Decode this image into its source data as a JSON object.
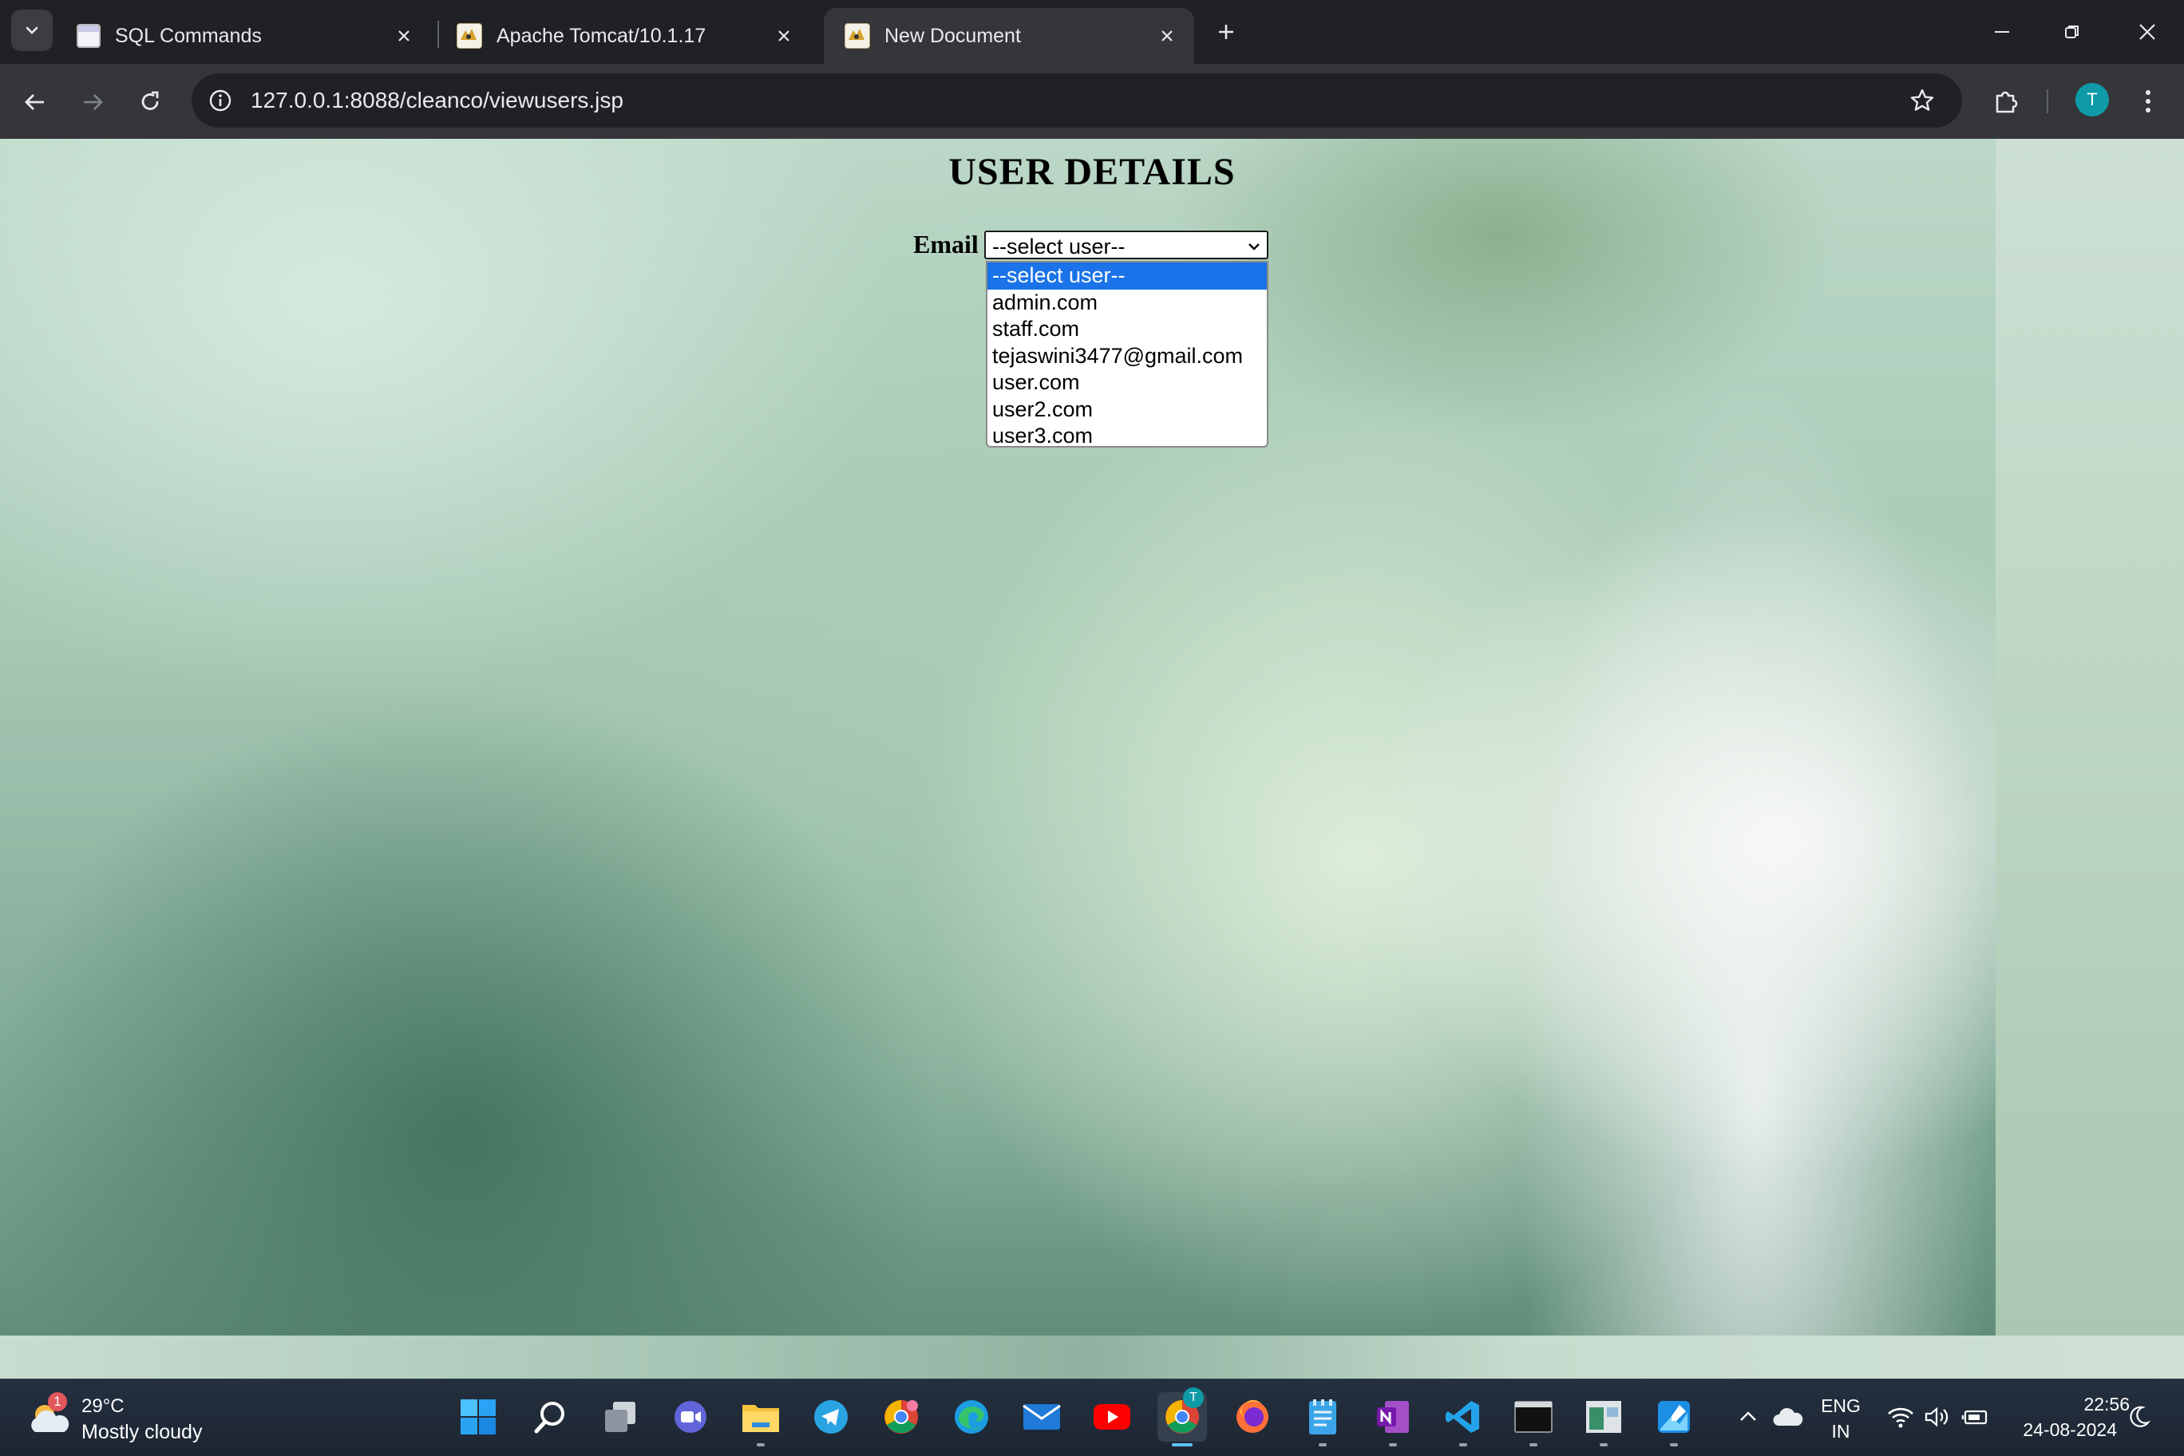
{
  "browser": {
    "tabs": [
      {
        "title": "SQL Commands",
        "favicon": "window-favicon",
        "active": false
      },
      {
        "title": "Apache Tomcat/10.1.17",
        "favicon": "tomcat-favicon",
        "active": false
      },
      {
        "title": "New Document",
        "favicon": "tomcat-favicon",
        "active": true
      }
    ],
    "url": "127.0.0.1:8088/cleanco/viewusers.jsp",
    "profile_initial": "T",
    "colors": {
      "frame": "#202124",
      "toolbar": "#35363a",
      "omnibox": "#202124",
      "profile": "#0e9aa7"
    }
  },
  "page": {
    "heading": "USER DETAILS",
    "email_label": "Email",
    "select": {
      "selected": "--select user--",
      "options": [
        "--select user--",
        "admin.com",
        "staff.com",
        "tejaswini3477@gmail.com",
        "user.com",
        "user2.com",
        "user3.com"
      ],
      "highlight_color": "#1a73e8"
    }
  },
  "taskbar": {
    "weather": {
      "temp": "29°C",
      "condition": "Mostly cloudy",
      "badge": "1"
    },
    "apps": [
      "windows-start-icon",
      "search-icon",
      "task-view-icon",
      "teams-icon",
      "file-explorer-icon",
      "telegram-icon",
      "chrome-k-icon",
      "edge-icon",
      "mail-icon",
      "youtube-icon",
      "chrome-icon",
      "firefox-icon",
      "notepad-icon",
      "onenote-icon",
      "vscode-icon",
      "terminal-icon",
      "app-icon",
      "photos-icon"
    ],
    "tray": {
      "lang_top": "ENG",
      "lang_bottom": "IN",
      "time": "22:56",
      "date": "24-08-2024",
      "chrome_badge": "T"
    }
  }
}
